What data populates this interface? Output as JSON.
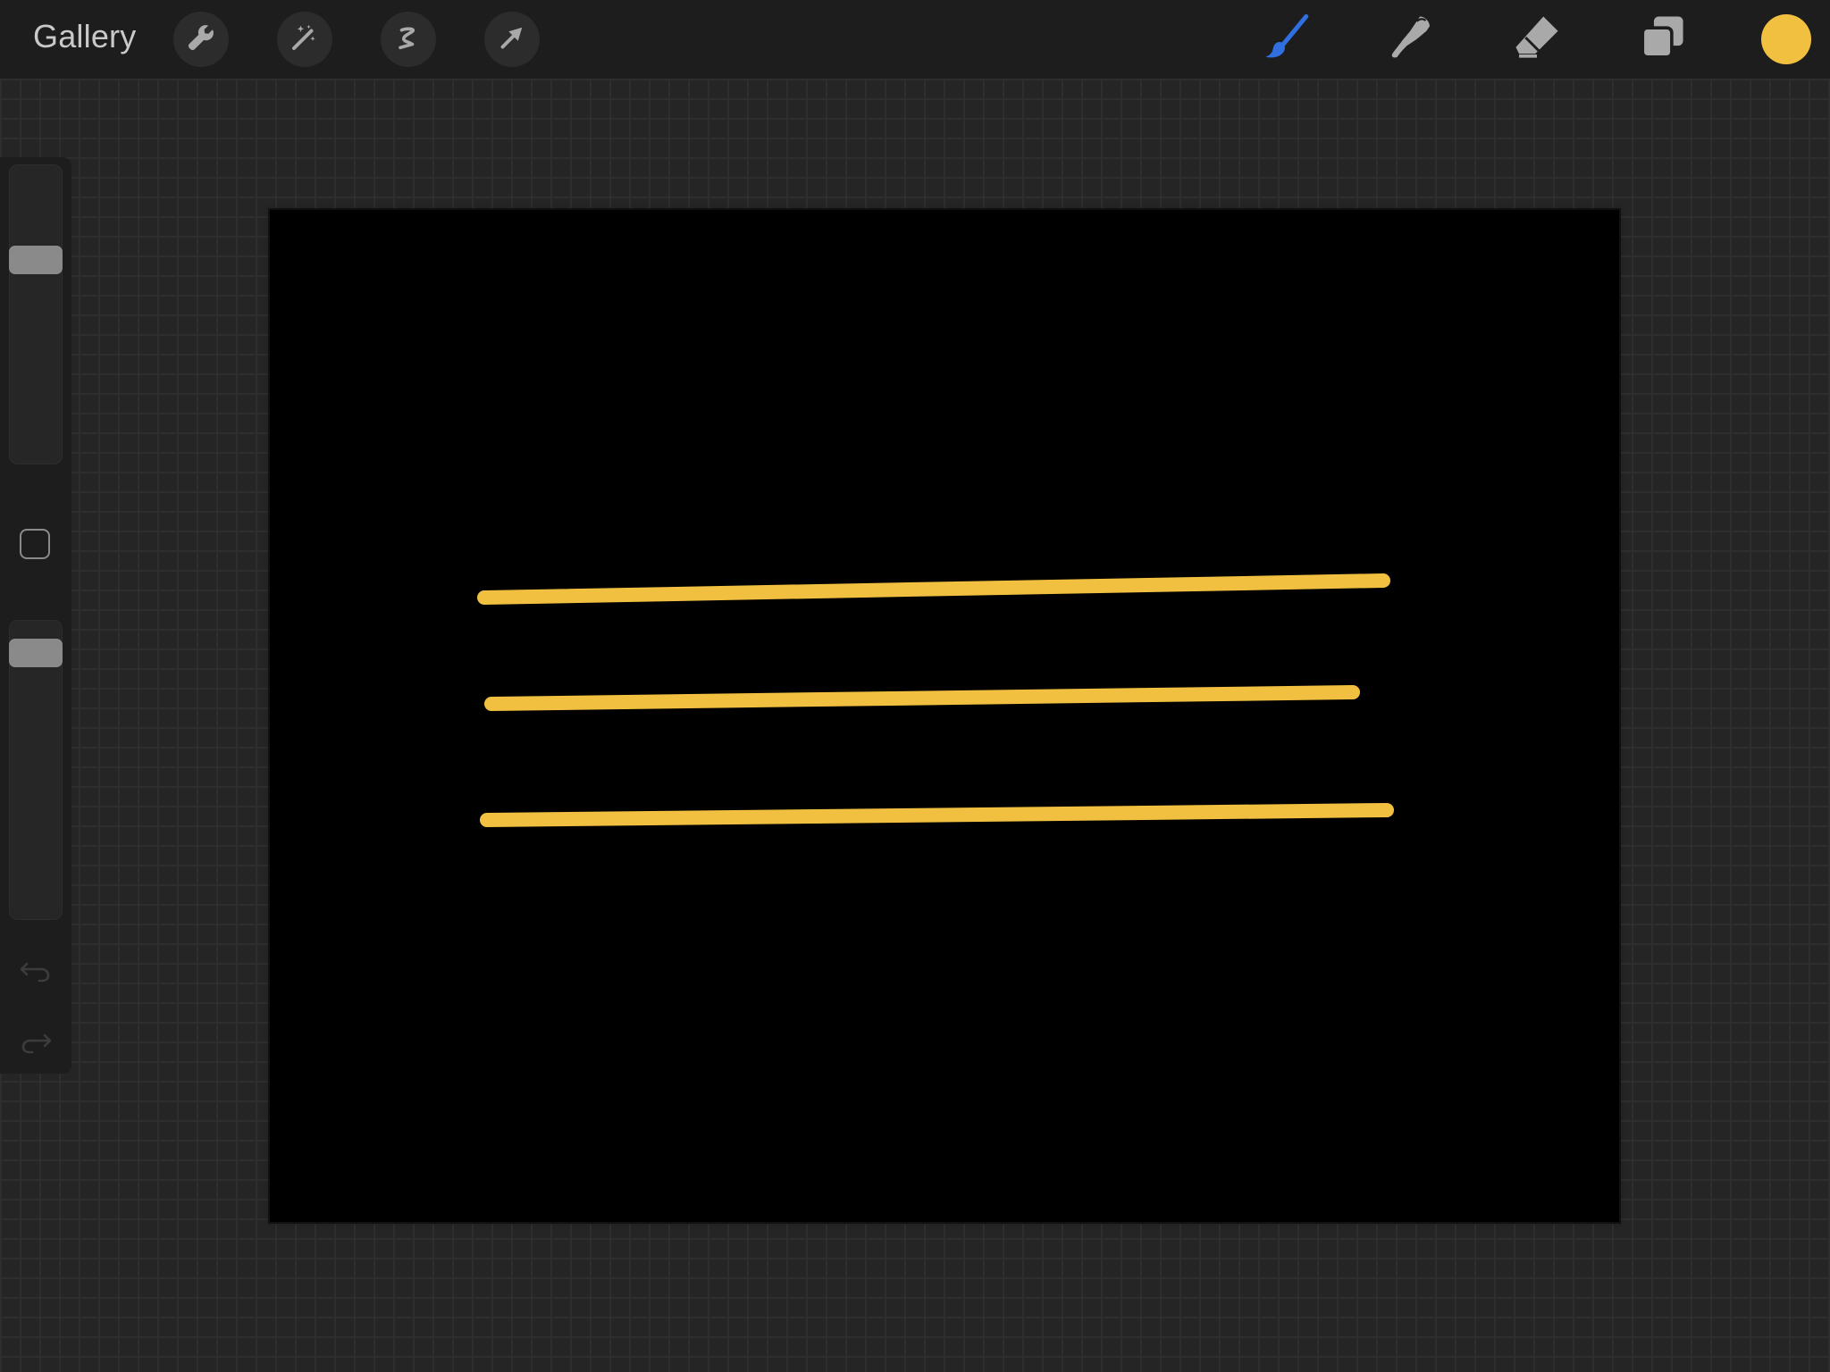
{
  "toolbar": {
    "gallery_label": "Gallery",
    "left_tools": [
      "actions-icon",
      "adjustments-icon",
      "selection-icon",
      "transform-icon"
    ],
    "right_tools": [
      "brush-icon",
      "smudge-icon",
      "eraser-icon",
      "layers-icon"
    ],
    "active_tool": "brush-icon",
    "active_tool_color": "#2f6fe0",
    "current_color": "#f2c040"
  },
  "sidebar": {
    "brush_size_level": 0.7,
    "opacity_level": 0.93,
    "modify_button": "modify-icon",
    "undo": "undo-icon",
    "redo": "redo-icon"
  },
  "canvas": {
    "background": "#000000",
    "stroke_color": "#f2c040",
    "stroke_count": 3
  }
}
